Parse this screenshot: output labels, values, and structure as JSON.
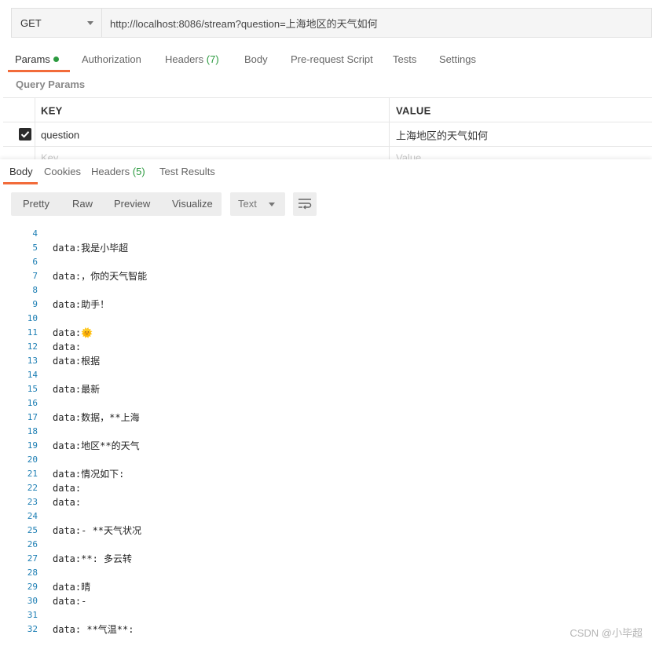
{
  "request": {
    "method": "GET",
    "url": "http://localhost:8086/stream?question=上海地区的天气如何"
  },
  "request_tabs": [
    {
      "label": "Params",
      "count": "",
      "dot": true
    },
    {
      "label": "Authorization",
      "count": ""
    },
    {
      "label": "Headers",
      "count": "(7)"
    },
    {
      "label": "Body",
      "count": ""
    },
    {
      "label": "Pre-request Script",
      "count": ""
    },
    {
      "label": "Tests",
      "count": ""
    },
    {
      "label": "Settings",
      "count": ""
    }
  ],
  "query_params": {
    "title": "Query Params",
    "headers": {
      "key": "KEY",
      "value": "VALUE"
    },
    "rows": [
      {
        "key": "question",
        "value": "上海地区的天气如何",
        "checked": true
      }
    ],
    "placeholder": {
      "key": "Key",
      "value": "Value"
    }
  },
  "response_tabs": [
    {
      "label": "Body",
      "count": ""
    },
    {
      "label": "Cookies",
      "count": ""
    },
    {
      "label": "Headers",
      "count": "(5)"
    },
    {
      "label": "Test Results",
      "count": ""
    }
  ],
  "view_modes": [
    "Pretty",
    "Raw",
    "Preview",
    "Visualize"
  ],
  "format_select": "Text",
  "code_lines": [
    {
      "n": "4",
      "t": ""
    },
    {
      "n": "5",
      "t": "data:我是小毕超"
    },
    {
      "n": "6",
      "t": ""
    },
    {
      "n": "7",
      "t": "data:，你的天气智能"
    },
    {
      "n": "8",
      "t": ""
    },
    {
      "n": "9",
      "t": "data:助手！"
    },
    {
      "n": "10",
      "t": ""
    },
    {
      "n": "11",
      "t": "data:🌞"
    },
    {
      "n": "12",
      "t": "data:"
    },
    {
      "n": "13",
      "t": "data:根据"
    },
    {
      "n": "14",
      "t": ""
    },
    {
      "n": "15",
      "t": "data:最新"
    },
    {
      "n": "16",
      "t": ""
    },
    {
      "n": "17",
      "t": "data:数据，**上海"
    },
    {
      "n": "18",
      "t": ""
    },
    {
      "n": "19",
      "t": "data:地区**的天气"
    },
    {
      "n": "20",
      "t": ""
    },
    {
      "n": "21",
      "t": "data:情况如下:"
    },
    {
      "n": "22",
      "t": "data:"
    },
    {
      "n": "23",
      "t": "data:"
    },
    {
      "n": "24",
      "t": ""
    },
    {
      "n": "25",
      "t": "data:- **天气状况"
    },
    {
      "n": "26",
      "t": ""
    },
    {
      "n": "27",
      "t": "data:**: 多云转"
    },
    {
      "n": "28",
      "t": ""
    },
    {
      "n": "29",
      "t": "data:晴"
    },
    {
      "n": "30",
      "t": "data:-"
    },
    {
      "n": "31",
      "t": ""
    },
    {
      "n": "32",
      "t": "data: **气温**:"
    }
  ],
  "watermark": "CSDN @小毕超"
}
